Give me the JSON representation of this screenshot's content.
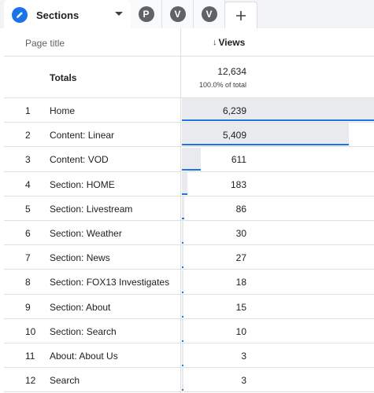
{
  "tabs": {
    "active": {
      "label": "Sections",
      "icon": "pencil-icon"
    },
    "segments": [
      {
        "letter": "P"
      },
      {
        "letter": "V"
      },
      {
        "letter": "V"
      }
    ],
    "add_label": "+"
  },
  "table": {
    "headers": {
      "title": "Page title",
      "views": "Views"
    },
    "totals": {
      "label": "Totals",
      "value": "12,634",
      "percent": "100.0% of total"
    },
    "rows": [
      {
        "rank": "1",
        "title": "Home",
        "views": "6,239",
        "share": 0.4938
      },
      {
        "rank": "2",
        "title": "Content: Linear",
        "views": "5,409",
        "share": 0.4281
      },
      {
        "rank": "3",
        "title": "Content: VOD",
        "views": "611",
        "share": 0.0484
      },
      {
        "rank": "4",
        "title": "Section: HOME",
        "views": "183",
        "share": 0.0145
      },
      {
        "rank": "5",
        "title": "Section: Livestream",
        "views": "86",
        "share": 0.0068
      },
      {
        "rank": "6",
        "title": "Section: Weather",
        "views": "30",
        "share": 0.0024
      },
      {
        "rank": "7",
        "title": "Section: News",
        "views": "27",
        "share": 0.0021
      },
      {
        "rank": "8",
        "title": "Section: FOX13 Investigates",
        "views": "18",
        "share": 0.0014
      },
      {
        "rank": "9",
        "title": "Section: About",
        "views": "15",
        "share": 0.0012
      },
      {
        "rank": "10",
        "title": "Section: Search",
        "views": "10",
        "share": 0.0008
      },
      {
        "rank": "11",
        "title": "About: About Us",
        "views": "3",
        "share": 0.0002
      },
      {
        "rank": "12",
        "title": "Search",
        "views": "3",
        "share": 0.0002
      }
    ]
  },
  "colors": {
    "accent": "#1a73e8",
    "bar_fill": "#e8eaed",
    "segment_badge": "#5f6368"
  }
}
